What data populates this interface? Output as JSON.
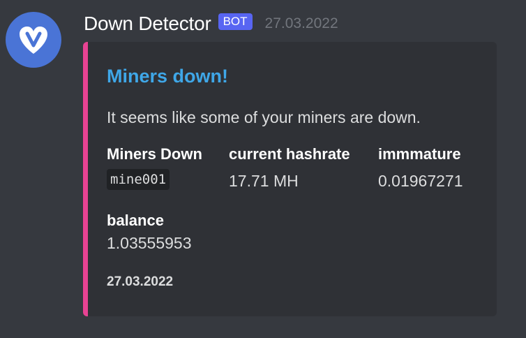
{
  "message": {
    "author": "Down Detector",
    "bot_tag": "BOT",
    "timestamp": "27.03.2022",
    "avatar_icon": "heart-check-icon",
    "avatar_color": "#4a74d6"
  },
  "embed": {
    "accent_color": "#e84393",
    "title": "Miners down!",
    "title_color": "#3fa7e8",
    "description": "It seems like some of your miners are down.",
    "fields": [
      {
        "name": "Miners Down",
        "value": "mine001",
        "is_code": true
      },
      {
        "name": "current hashrate",
        "value": "17.71 MH",
        "is_code": false
      },
      {
        "name": "immmature",
        "value": "0.01967271",
        "is_code": false
      },
      {
        "name": "balance",
        "value": "1.03555953",
        "is_code": false
      }
    ],
    "footer": "27.03.2022"
  }
}
